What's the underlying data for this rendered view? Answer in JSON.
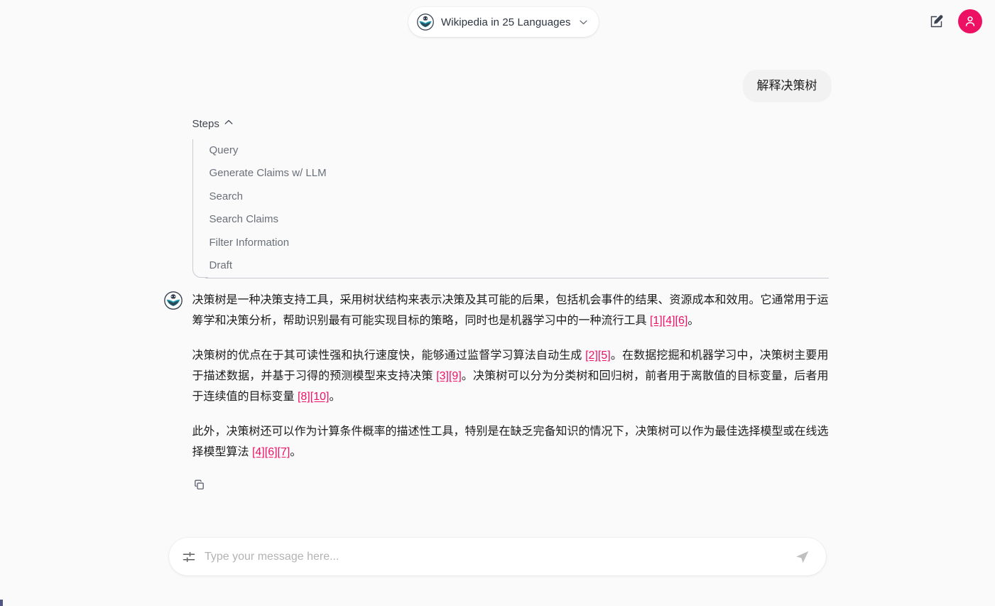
{
  "topbar": {
    "model_selector": {
      "label": "Wikipedia in 25 Languages",
      "logo_icon": "wikipedia-logo-icon",
      "chevron": "⌄",
      "chevron_icon": "chevron-down-icon"
    },
    "edit_icon": "edit-square-icon",
    "avatar_icon": "user-avatar-icon",
    "avatar_color": "#ed1164"
  },
  "conversation": {
    "user_message": {
      "text": "解释决策树"
    },
    "steps": {
      "header_label": "Steps",
      "caret": "⌃",
      "expanded": true,
      "items": [
        {
          "label": "Query"
        },
        {
          "label": "Generate Claims w/ LLM"
        },
        {
          "label": "Search"
        },
        {
          "label": "Search Claims"
        },
        {
          "label": "Filter Information"
        },
        {
          "label": "Draft"
        }
      ]
    },
    "assistant_message": {
      "avatar_icon": "wikipedia-logo-icon",
      "citation_color": "#ee1164",
      "paragraphs": [
        [
          {
            "t": "text",
            "v": "决策树是一种决策支持工具，采用树状结构来表示决策及其可能的后果，包括机会事件的结果、资源成本和效用。它通常用于运筹学和决策分析，帮助识别最有可能实现目标的策略，同时也是机器学习中的一种流行工具 "
          },
          {
            "t": "cite",
            "v": "[1][4][6]"
          },
          {
            "t": "text",
            "v": "。"
          }
        ],
        [
          {
            "t": "text",
            "v": "决策树的优点在于其可读性强和执行速度快，能够通过监督学习算法自动生成 "
          },
          {
            "t": "cite",
            "v": "[2][5]"
          },
          {
            "t": "text",
            "v": "。在数据挖掘和机器学习中，决策树主要用于描述数据，并基于习得的预测模型来支持决策 "
          },
          {
            "t": "cite",
            "v": "[3][9]"
          },
          {
            "t": "text",
            "v": "。决策树可以分为分类树和回归树，前者用于离散值的目标变量，后者用于连续值的目标变量 "
          },
          {
            "t": "cite",
            "v": "[8][10]"
          },
          {
            "t": "text",
            "v": "。"
          }
        ],
        [
          {
            "t": "text",
            "v": "此外，决策树还可以作为计算条件概率的描述性工具，特别是在缺乏完备知识的情况下，决策树可以作为最佳选择模型或在线选择模型算法 "
          },
          {
            "t": "cite",
            "v": "[4][6][7]"
          },
          {
            "t": "text",
            "v": "。"
          }
        ]
      ],
      "actions": [
        {
          "icon": "copy-icon",
          "name": "copy-message-button"
        }
      ]
    }
  },
  "composer": {
    "settings_icon": "tune-sliders-icon",
    "placeholder": "Type your message here...",
    "value": "",
    "send_icon": "send-paper-plane-icon"
  }
}
